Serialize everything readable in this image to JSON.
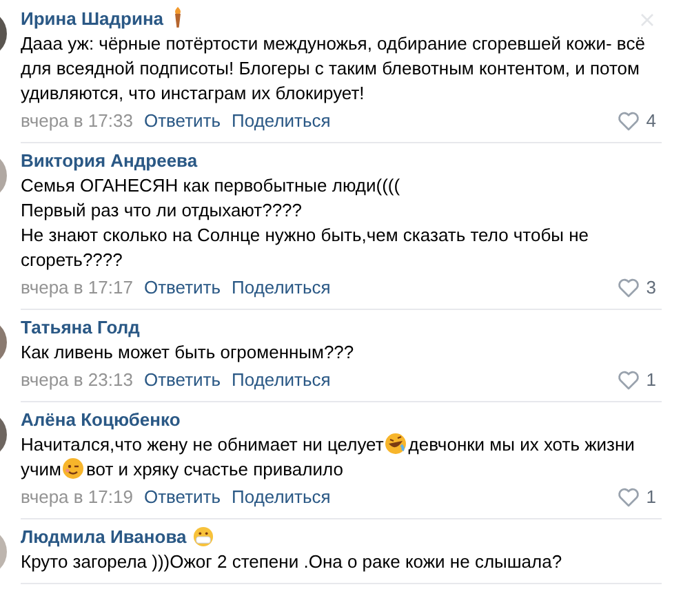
{
  "comments": [
    {
      "author": "Ирина Шадрина",
      "badges": [
        {
          "kind": "torch"
        }
      ],
      "actions": [
        {
          "kind": "close"
        }
      ],
      "lines": [
        [
          {
            "kind": "text",
            "text": "Дааа уж: чёрные потёртости междуножья, одбирание сгоревшей кожи- всё"
          }
        ],
        [
          {
            "kind": "text",
            "text": "для всеядной подписоты! Блогеры с таким блевотным контентом, и потом"
          }
        ],
        [
          {
            "kind": "text",
            "text": "удивляются, что инстаграм их блокирует!"
          }
        ]
      ],
      "time": "вчера в 17:33",
      "reply": "Ответить",
      "share": "Поделиться",
      "likes": "4"
    },
    {
      "author": "Виктория Андреева",
      "lines": [
        [
          {
            "kind": "text",
            "text": "Семья ОГАНЕСЯН как первобытные люди(((("
          }
        ],
        [
          {
            "kind": "text",
            "text": "Первый раз что ли отдыхают????"
          }
        ],
        [
          {
            "kind": "text",
            "text": "Не знают сколько на Солнце нужно быть,чем сказать тело чтобы не"
          }
        ],
        [
          {
            "kind": "text",
            "text": "сгореть????"
          }
        ]
      ],
      "time": "вчера в 17:17",
      "reply": "Ответить",
      "share": "Поделиться",
      "likes": "3"
    },
    {
      "author": "Татьяна Голд",
      "lines": [
        [
          {
            "kind": "text",
            "text": "Как ливень может быть огроменным???"
          }
        ]
      ],
      "time": "вчера в 23:13",
      "reply": "Ответить",
      "share": "Поделиться",
      "likes": "1"
    },
    {
      "author": "Алёна Коцюбенко",
      "lines": [
        [
          {
            "kind": "text",
            "text": "Начитался,что жену не обнимает ни целует"
          },
          {
            "kind": "laughing"
          },
          {
            "kind": "text",
            "text": "девчонки мы их хоть жизни"
          }
        ],
        [
          {
            "kind": "text",
            "text": "учим"
          },
          {
            "kind": "winking"
          },
          {
            "kind": "text",
            "text": "вот и хряку счастье привалило"
          }
        ]
      ],
      "time": "вчера в 17:19",
      "reply": "Ответить",
      "share": "Поделиться",
      "likes": "1"
    },
    {
      "author": "Людмила Иванова",
      "badges": [
        {
          "kind": "mask"
        }
      ],
      "lines": [
        [
          {
            "kind": "text",
            "text": "Круто загорела )))Ожог 2 степени .Она о раке кожи не слышала?"
          }
        ]
      ]
    }
  ]
}
